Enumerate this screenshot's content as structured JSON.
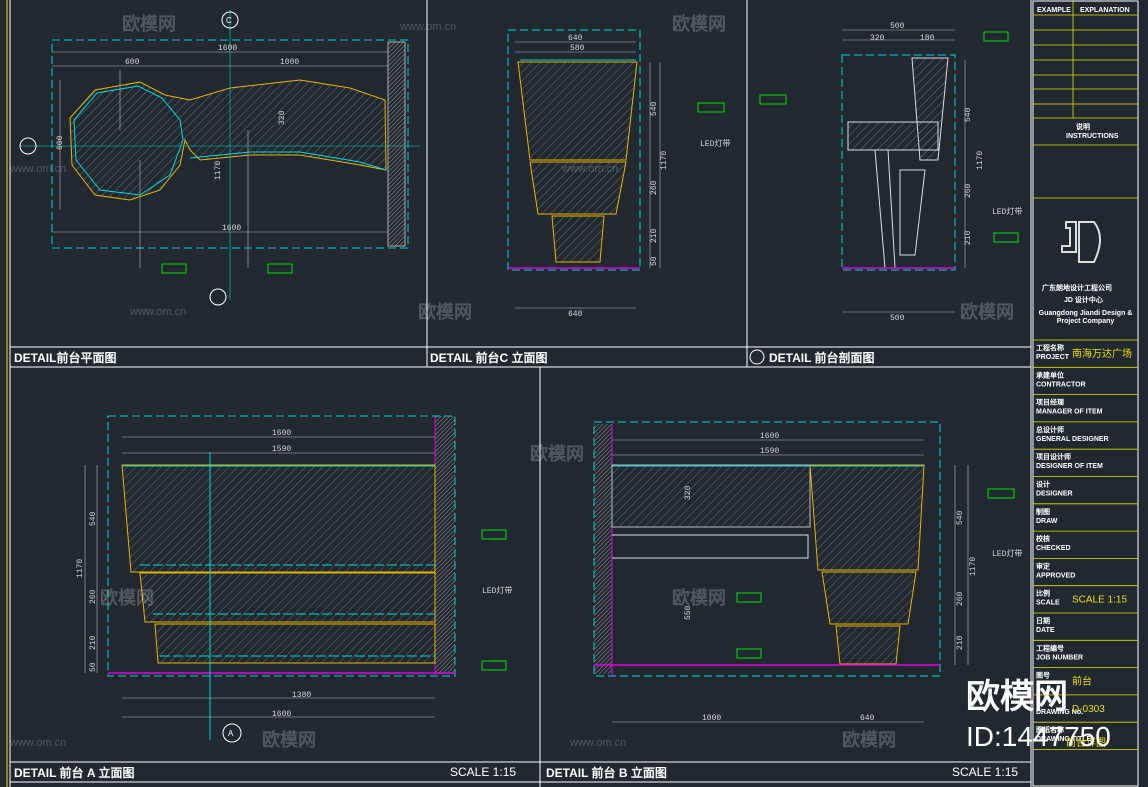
{
  "panels": {
    "plan": {
      "title": "DETAIL前台平面图",
      "dims": [
        "1600",
        "600",
        "1000",
        "1600",
        "600",
        "320",
        "1170"
      ],
      "marker": "C"
    },
    "elev_c": {
      "title": "DETAIL 前台C 立面图",
      "dims": [
        "640",
        "580",
        "540",
        "1170",
        "260",
        "210",
        "50",
        "640",
        "LED灯带"
      ]
    },
    "section": {
      "title": "DETAIL 前台剖面图",
      "dims": [
        "500",
        "320",
        "180",
        "540",
        "1170",
        "260",
        "210",
        "500",
        "LED灯带"
      ]
    },
    "elev_a": {
      "title": "DETAIL 前台 A 立面图",
      "scale": "SCALE 1:15",
      "dims": [
        "1600",
        "1590",
        "540",
        "1170",
        "260",
        "210",
        "50",
        "1380",
        "1600",
        "LED灯带"
      ],
      "marker": "A"
    },
    "elev_b": {
      "title": "DETAIL 前台 B 立面图",
      "scale": "SCALE 1:15",
      "dims": [
        "1600",
        "1590",
        "320",
        "1170",
        "550",
        "540",
        "260",
        "210",
        "1000",
        "640",
        "LED灯带"
      ]
    }
  },
  "title_block": {
    "header": [
      "EXAMPLE",
      "EXPLANATION"
    ],
    "instructions_cn": "说明",
    "instructions_en": "INSTRUCTIONS",
    "logo": "JD",
    "company_cn": "广东朗地设计工程公司",
    "company_sub": "JD 设计中心",
    "company_en": "Guangdong Jiandi Design & Project Company",
    "rows": [
      {
        "cn": "工程名称",
        "en": "PROJECT",
        "value": "南海万达广场"
      },
      {
        "cn": "承建单位",
        "en": "CONTRACTOR",
        "value": ""
      },
      {
        "cn": "项目经理",
        "en": "MANAGER OF ITEM",
        "value": ""
      },
      {
        "cn": "总设计师",
        "en": "GENERAL DESIGNER",
        "value": ""
      },
      {
        "cn": "项目设计师",
        "en": "DESIGNER OF ITEM",
        "value": ""
      },
      {
        "cn": "设计",
        "en": "DESIGNER",
        "value": ""
      },
      {
        "cn": "制图",
        "en": "DRAW",
        "value": ""
      },
      {
        "cn": "校核",
        "en": "CHECKED",
        "value": ""
      },
      {
        "cn": "审定",
        "en": "APPROVED",
        "value": ""
      },
      {
        "cn": "比例",
        "en": "SCALE",
        "value": "SCALE 1:15"
      },
      {
        "cn": "日期",
        "en": "DATE",
        "value": ""
      },
      {
        "cn": "工程编号",
        "en": "JOB NUMBER",
        "value": ""
      },
      {
        "cn": "图号",
        "en": "",
        "value": "前台"
      },
      {
        "cn": "",
        "en": "DRAWING No.",
        "value": "D-0303"
      },
      {
        "cn": "图纸名称",
        "en": "DRAWING TITLE",
        "value": "前台详图"
      }
    ]
  },
  "watermark": {
    "site": "www.om.cn",
    "brand": "欧模网",
    "brand_large": "欧模网",
    "id": "ID:1447750"
  }
}
